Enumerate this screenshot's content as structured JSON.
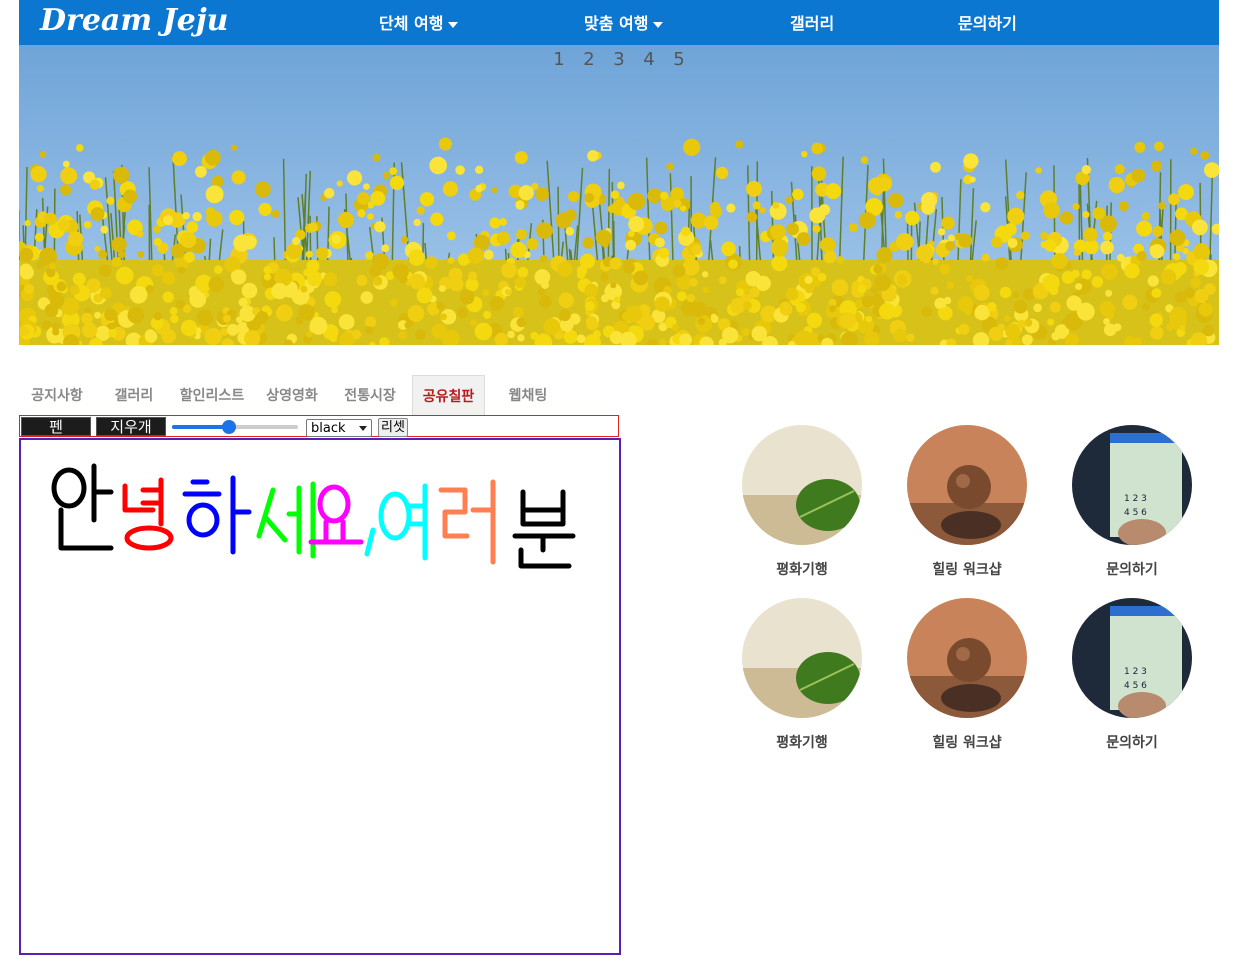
{
  "navbar": {
    "logo": "Dream Jeju",
    "items": [
      {
        "label": "단체 여행",
        "dropdown": true
      },
      {
        "label": "맞춤 여행",
        "dropdown": true
      },
      {
        "label": "갤러리",
        "dropdown": false
      },
      {
        "label": "문의하기",
        "dropdown": false
      }
    ],
    "color": "#0b77d1"
  },
  "banner": {
    "pages": [
      "1",
      "2",
      "3",
      "4",
      "5"
    ]
  },
  "tabs": [
    {
      "label": "공지사항"
    },
    {
      "label": "갤러리"
    },
    {
      "label": "할인리스트"
    },
    {
      "label": "상영영화"
    },
    {
      "label": "전통시장"
    },
    {
      "label": "공유칠판",
      "active": true
    },
    {
      "label": "웹채팅"
    }
  ],
  "board": {
    "pen_label": "펜",
    "eraser_label": "지우개",
    "thickness_level": 0.45,
    "color_select": "black",
    "reset_label": "리셋",
    "drawing_colors": [
      "#000000",
      "#ff0000",
      "#0000ff",
      "#00ff00",
      "#ff00ff",
      "#00ffff",
      "#ff7f50",
      "#000000"
    ]
  },
  "gallery": [
    {
      "caption": "평화기행",
      "icon": "leaf-photo"
    },
    {
      "caption": "힐링 워크샵",
      "icon": "stone-photo"
    },
    {
      "caption": "문의하기",
      "icon": "phone-photo"
    },
    {
      "caption": "평화기행",
      "icon": "leaf-photo"
    },
    {
      "caption": "힐링 워크샵",
      "icon": "stone-photo"
    },
    {
      "caption": "문의하기",
      "icon": "phone-photo"
    }
  ]
}
